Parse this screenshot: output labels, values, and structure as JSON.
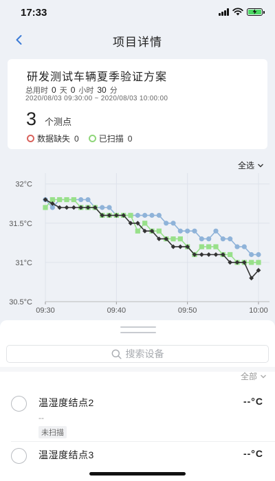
{
  "status": {
    "time": "17:33"
  },
  "nav": {
    "title": "项目详情"
  },
  "project": {
    "title": "研发测试车辆夏季验证方案",
    "total_time_label": "总用时",
    "days": "0",
    "days_unit": "天",
    "hours": "0",
    "hours_unit": "小时",
    "minutes": "30",
    "minutes_unit": "分",
    "time_range": "2020/08/03 09:30:00 ~ 2020/08/03 10:00:00",
    "point_count": "3",
    "point_label": "个测点",
    "missing_label": "数据缺失",
    "missing_count": "0",
    "scanned_label": "已扫描",
    "scanned_count": "0"
  },
  "chart_controls": {
    "select_all": "全选"
  },
  "chart_data": {
    "type": "line",
    "title": "",
    "xlabel": "",
    "ylabel": "",
    "y_tick_labels": [
      "32°C",
      "31.5°C",
      "31°C",
      "30.5°C"
    ],
    "y_ticks": [
      32,
      31.5,
      31,
      30.5
    ],
    "ylim": [
      30.5,
      32.05
    ],
    "x_tick_labels": [
      "09:30",
      "09:40",
      "09:50",
      "10:00"
    ],
    "x_ticks": [
      0,
      10,
      20,
      30
    ],
    "xlim": [
      0,
      30
    ],
    "grid": true,
    "series": [
      {
        "color": "#8fb3d9",
        "marker": "circle",
        "x": [
          0,
          1,
          2,
          3,
          4,
          5,
          6,
          7,
          8,
          9,
          10,
          11,
          12,
          13,
          14,
          15,
          16,
          17,
          18,
          19,
          20,
          21,
          22,
          23,
          24,
          25,
          26,
          27,
          28,
          29,
          30
        ],
        "values": [
          31.8,
          31.7,
          31.8,
          31.8,
          31.8,
          31.8,
          31.8,
          31.7,
          31.7,
          31.7,
          31.6,
          31.6,
          31.6,
          31.6,
          31.6,
          31.6,
          31.6,
          31.5,
          31.5,
          31.4,
          31.4,
          31.4,
          31.3,
          31.3,
          31.4,
          31.3,
          31.3,
          31.2,
          31.2,
          31.1,
          31.1
        ]
      },
      {
        "color": "#98e08a",
        "marker": "square",
        "x": [
          0,
          1,
          2,
          3,
          4,
          5,
          6,
          7,
          8,
          9,
          10,
          11,
          12,
          13,
          14,
          15,
          16,
          17,
          18,
          19,
          20,
          21,
          22,
          23,
          24,
          25,
          26,
          27,
          28,
          29,
          30
        ],
        "values": [
          31.7,
          31.8,
          31.8,
          31.8,
          31.8,
          31.7,
          31.7,
          31.7,
          31.6,
          31.6,
          31.6,
          31.6,
          31.6,
          31.4,
          31.5,
          31.4,
          31.4,
          31.3,
          31.3,
          31.3,
          31.2,
          31.1,
          31.2,
          31.2,
          31.2,
          31.1,
          31.1,
          31.0,
          31.0,
          31.0,
          31.0
        ]
      },
      {
        "color": "#333333",
        "marker": "diamond",
        "x": [
          0,
          1,
          2,
          3,
          4,
          5,
          6,
          7,
          8,
          9,
          10,
          11,
          12,
          13,
          14,
          15,
          16,
          17,
          18,
          19,
          20,
          21,
          22,
          23,
          24,
          25,
          26,
          27,
          28,
          29,
          30
        ],
        "values": [
          31.8,
          31.75,
          31.7,
          31.7,
          31.7,
          31.7,
          31.7,
          31.7,
          31.6,
          31.6,
          31.6,
          31.6,
          31.5,
          31.5,
          31.4,
          31.4,
          31.3,
          31.3,
          31.2,
          31.2,
          31.2,
          31.1,
          31.1,
          31.1,
          31.1,
          31.1,
          31.0,
          31.0,
          31.0,
          30.8,
          30.9
        ]
      }
    ]
  },
  "search": {
    "placeholder": "搜索设备"
  },
  "filter": {
    "label": "全部"
  },
  "nodes": [
    {
      "name": "温湿度结点2",
      "temp": "--°C",
      "humidity": "--",
      "tag": "未扫描"
    },
    {
      "name": "温湿度结点3",
      "temp": "--°C"
    }
  ]
}
